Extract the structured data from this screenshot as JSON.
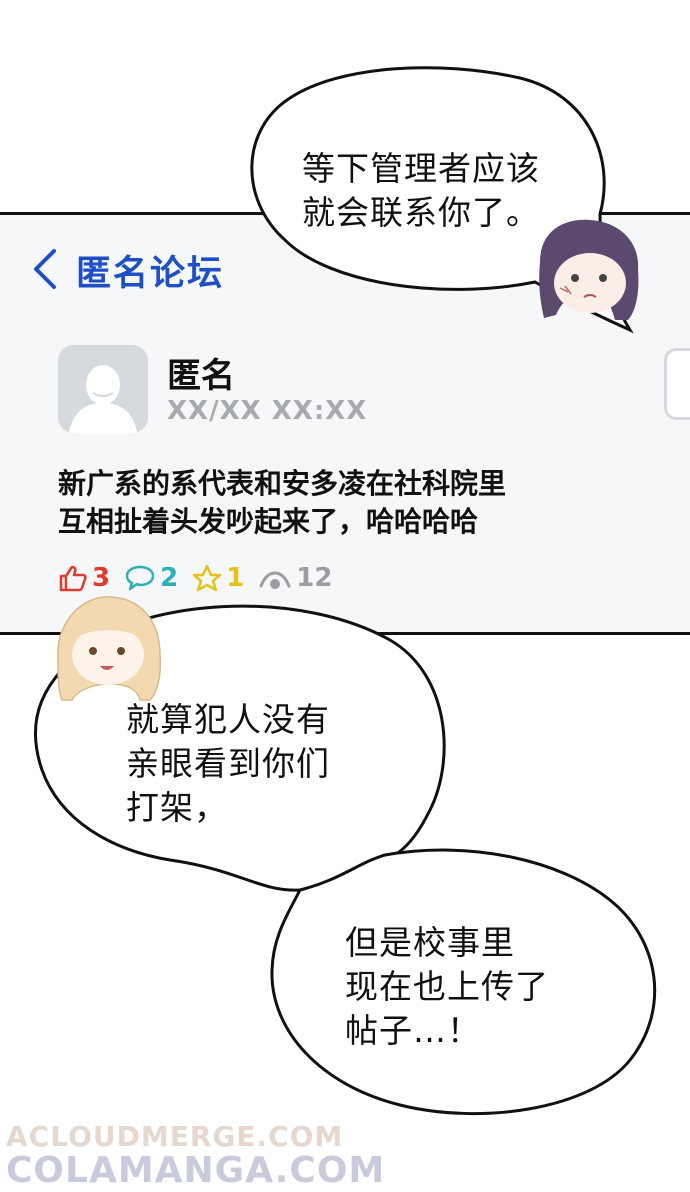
{
  "forum": {
    "title": "匿名论坛",
    "author": "匿名",
    "time": "XX/XX XX:XX",
    "post_lines": [
      "新广系的系代表和安多凌在社科院里",
      "互相扯着头发吵起来了，哈哈哈哈"
    ],
    "stats": {
      "likes": "3",
      "comments": "2",
      "favorites": "1",
      "views": "12"
    },
    "colors": {
      "title": "#1f4fc7",
      "likes": "#e03a2e",
      "comments": "#2bb0b4",
      "favorites": "#e8c21a",
      "views": "#9a9ea3"
    }
  },
  "bubbles": {
    "top_lines": [
      "等下管理者应该",
      "就会联系你了。"
    ],
    "middle_lines": [
      "就算犯人没有",
      "亲眼看到你们",
      "打架，"
    ],
    "bottom_lines": [
      "但是校事里",
      "现在也上传了",
      "帖子…！"
    ]
  },
  "watermark": {
    "line1": "ACLOUDMERGE.COM",
    "line2": "COLAMANGA.COM"
  }
}
